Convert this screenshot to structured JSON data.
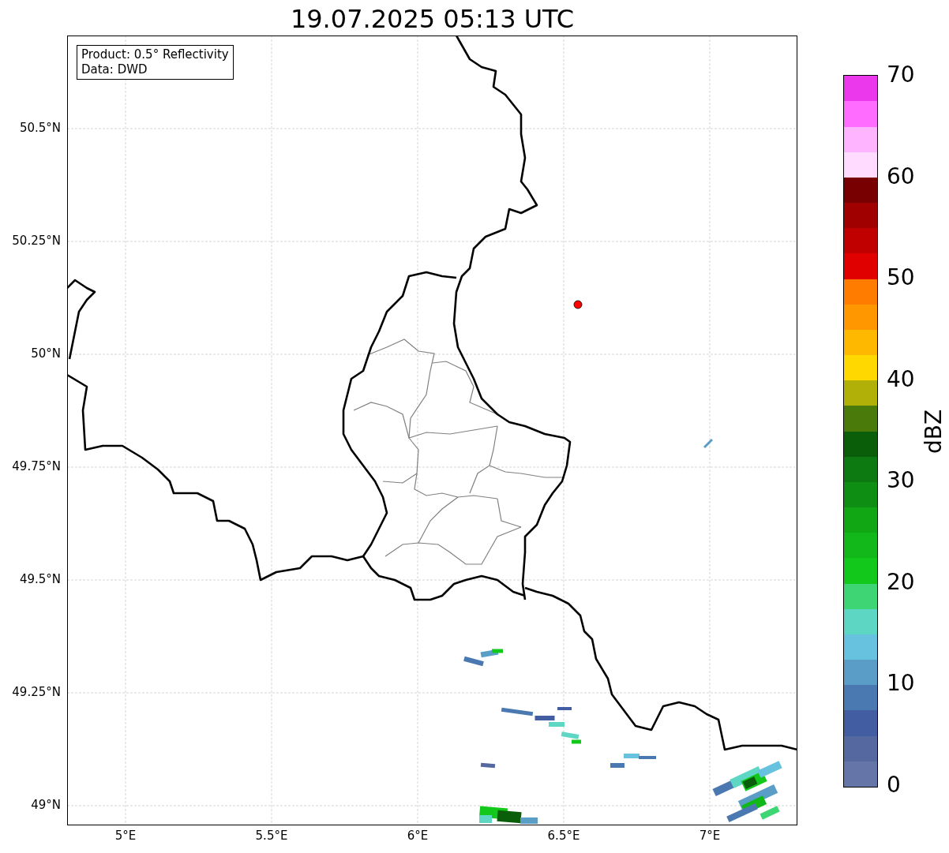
{
  "title": "19.07.2025 05:13 UTC",
  "legend": {
    "lines": [
      "Product: 0.5° Reflectivity",
      "Data: DWD"
    ]
  },
  "lat_ticks": [
    "50.5°N",
    "50.25°N",
    "50°N",
    "49.75°N",
    "49.5°N",
    "49.25°N",
    "49°N"
  ],
  "lon_ticks": [
    "5°E",
    "5.5°E",
    "6°E",
    "6.5°E",
    "7°E"
  ],
  "colorbar": {
    "label": "dBZ",
    "ticks": [
      "70",
      "60",
      "50",
      "40",
      "30",
      "20",
      "10",
      "0"
    ],
    "segments": [
      {
        "color": "#6575a8"
      },
      {
        "color": "#5568a0"
      },
      {
        "color": "#425da2"
      },
      {
        "color": "#4a78b0"
      },
      {
        "color": "#5a9ec8"
      },
      {
        "color": "#66c2de"
      },
      {
        "color": "#5ed6c4"
      },
      {
        "color": "#3ed674"
      },
      {
        "color": "#12c81a"
      },
      {
        "color": "#12b81a"
      },
      {
        "color": "#10a614"
      },
      {
        "color": "#0e8e12"
      },
      {
        "color": "#0c7a10"
      },
      {
        "color": "#0a5e0a"
      },
      {
        "color": "#4a7a0a"
      },
      {
        "color": "#b0b008"
      },
      {
        "color": "#ffd800"
      },
      {
        "color": "#ffb800"
      },
      {
        "color": "#ff9800"
      },
      {
        "color": "#ff7c00"
      },
      {
        "color": "#e00000"
      },
      {
        "color": "#c00000"
      },
      {
        "color": "#a00000"
      },
      {
        "color": "#780000"
      },
      {
        "color": "#ffdcff"
      },
      {
        "color": "#ffb4ff"
      },
      {
        "color": "#ff6cff"
      },
      {
        "color": "#ec38ec"
      }
    ]
  }
}
